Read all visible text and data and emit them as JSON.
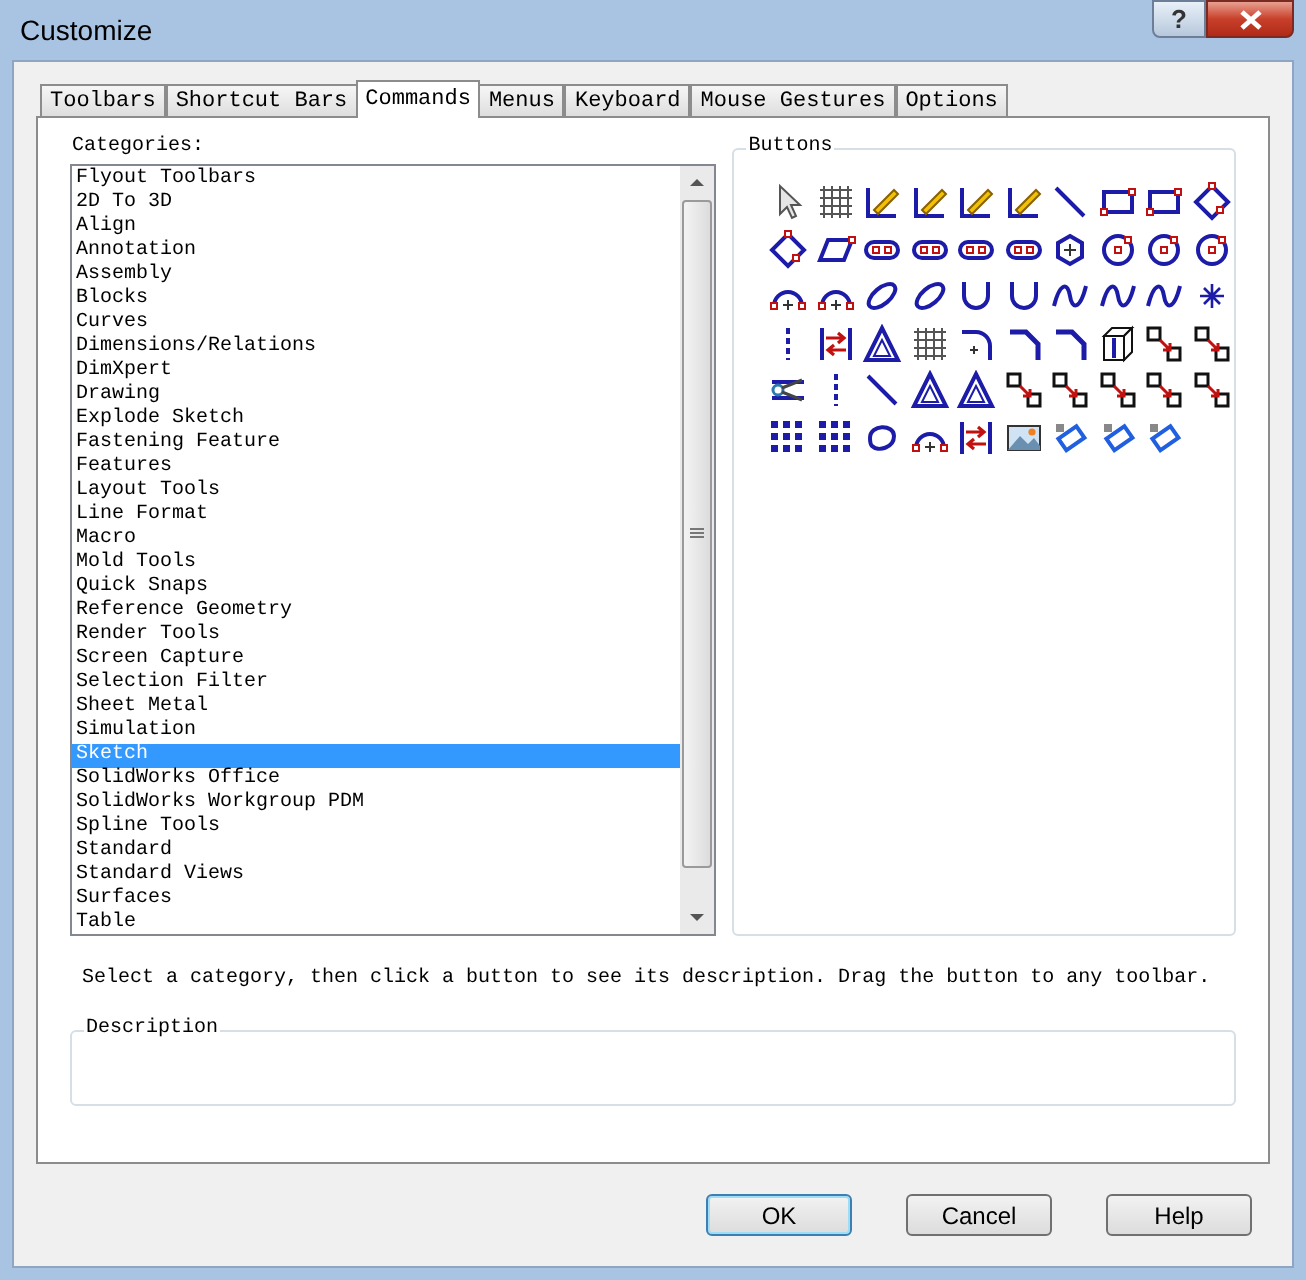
{
  "window": {
    "title": "Customize",
    "help_button": "?"
  },
  "tabs": [
    {
      "label": "Toolbars",
      "selected": false
    },
    {
      "label": "Shortcut Bars",
      "selected": false
    },
    {
      "label": "Commands",
      "selected": true
    },
    {
      "label": "Menus",
      "selected": false
    },
    {
      "label": "Keyboard",
      "selected": false
    },
    {
      "label": "Mouse Gestures",
      "selected": false
    },
    {
      "label": "Options",
      "selected": false
    }
  ],
  "categories": {
    "label": "Categories:",
    "items": [
      {
        "label": "Flyout Toolbars",
        "selected": false
      },
      {
        "label": "2D To 3D",
        "selected": false
      },
      {
        "label": "Align",
        "selected": false
      },
      {
        "label": "Annotation",
        "selected": false
      },
      {
        "label": "Assembly",
        "selected": false
      },
      {
        "label": "Blocks",
        "selected": false
      },
      {
        "label": "Curves",
        "selected": false
      },
      {
        "label": "Dimensions/Relations",
        "selected": false
      },
      {
        "label": "DimXpert",
        "selected": false
      },
      {
        "label": "Drawing",
        "selected": false
      },
      {
        "label": "Explode Sketch",
        "selected": false
      },
      {
        "label": "Fastening Feature",
        "selected": false
      },
      {
        "label": "Features",
        "selected": false
      },
      {
        "label": "Layout Tools",
        "selected": false
      },
      {
        "label": "Line Format",
        "selected": false
      },
      {
        "label": "Macro",
        "selected": false
      },
      {
        "label": "Mold Tools",
        "selected": false
      },
      {
        "label": "Quick Snaps",
        "selected": false
      },
      {
        "label": "Reference Geometry",
        "selected": false
      },
      {
        "label": "Render Tools",
        "selected": false
      },
      {
        "label": "Screen Capture",
        "selected": false
      },
      {
        "label": "Selection Filter",
        "selected": false
      },
      {
        "label": "Sheet Metal",
        "selected": false
      },
      {
        "label": "Simulation",
        "selected": false
      },
      {
        "label": "Sketch",
        "selected": true
      },
      {
        "label": "SolidWorks Office",
        "selected": false
      },
      {
        "label": "SolidWorks Workgroup PDM",
        "selected": false
      },
      {
        "label": "Spline Tools",
        "selected": false
      },
      {
        "label": "Standard",
        "selected": false
      },
      {
        "label": "Standard Views",
        "selected": false
      },
      {
        "label": "Surfaces",
        "selected": false
      },
      {
        "label": "Table",
        "selected": false
      }
    ]
  },
  "buttons_group": {
    "label": "Buttons"
  },
  "hint": "Select a category, then click a button to see its description. Drag the button to any toolbar.",
  "description": {
    "label": "Description"
  },
  "dialog_buttons": [
    {
      "label": "OK",
      "default": true
    },
    {
      "label": "Cancel",
      "default": false
    },
    {
      "label": "Help",
      "default": false
    }
  ]
}
